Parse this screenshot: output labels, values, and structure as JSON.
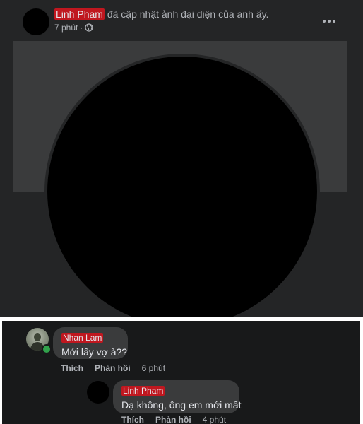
{
  "post": {
    "author": "Linh Pham",
    "action_text": "đã cập nhật ảnh đại diện của anh ấy.",
    "time": "7 phút",
    "separator": "·",
    "privacy_icon": "globe-icon",
    "more_icon": "more-options-icon"
  },
  "comments": [
    {
      "author": "Nhan Lam",
      "text": "Mới lấy vợ à??",
      "like_label": "Thích",
      "reply_label": "Phản hồi",
      "time": "6 phút",
      "online": true
    },
    {
      "author": "Linh Pham",
      "text": "Dạ không, ông em mới mất",
      "like_label": "Thích",
      "reply_label": "Phản hồi",
      "time": "4 phút"
    }
  ],
  "colors": {
    "post_bg": "#242526",
    "comments_bg": "#18191a",
    "bubble_bg": "#3a3b3c",
    "redaction": "#c0171f",
    "online": "#31a24c"
  }
}
